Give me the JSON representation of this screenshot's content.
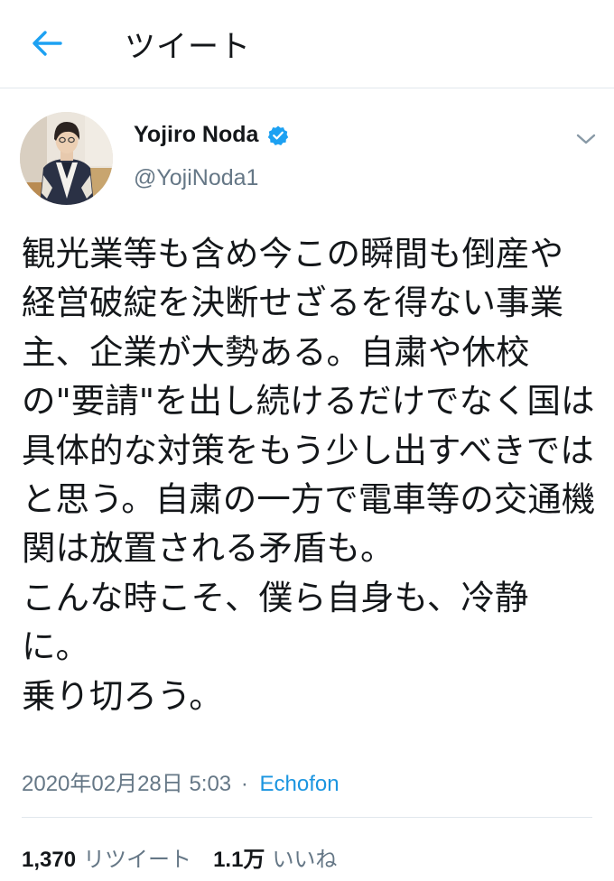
{
  "header": {
    "title": "ツイート",
    "accent_color": "#1da1f2"
  },
  "author": {
    "name": "Yojiro Noda",
    "handle": "@YojiNoda1",
    "verified": true
  },
  "tweet": {
    "text": "観光業等も含め今この瞬間も倒産や経営破綻を決断せざるを得ない事業主、企業が大勢ある。自粛や休校の\"要請\"を出し続けるだけでなく国は具体的な対策をもう少し出すべきではと思う。自粛の一方で電車等の交通機関は放置される矛盾も。\nこんな時こそ、僕ら自身も、冷静に。\n乗り切ろう。",
    "timestamp": "2020年02月28日 5:03",
    "separator": "·",
    "source": "Echofon"
  },
  "stats": {
    "retweets": {
      "count": "1,370",
      "label": "リツイート"
    },
    "likes": {
      "count": "1.1万",
      "label": "いいね"
    }
  },
  "icons": {
    "back": "back-arrow-icon",
    "verified": "verified-badge-icon",
    "caret": "chevron-down-icon"
  }
}
